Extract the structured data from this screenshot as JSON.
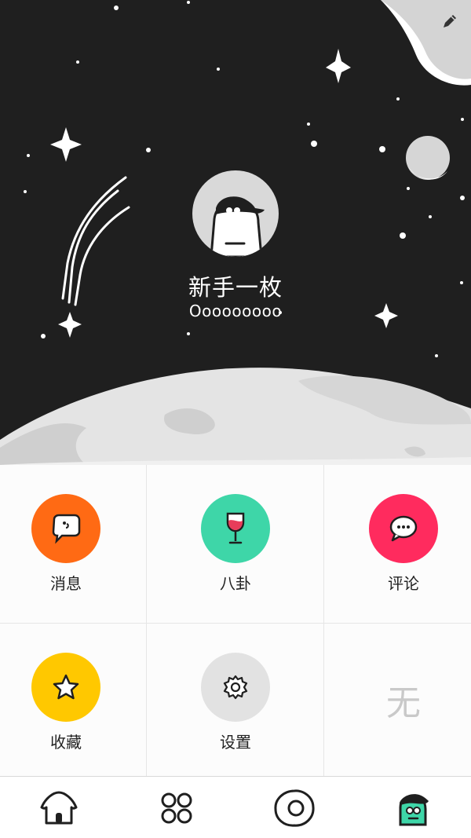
{
  "profile": {
    "name": "新手一枚",
    "signature": "Ooooooooo"
  },
  "grid": {
    "items": [
      {
        "label": "消息",
        "icon": "message-icon",
        "color": "#ff6a14"
      },
      {
        "label": "八卦",
        "icon": "wine-glass-icon",
        "color": "#3ed6a8"
      },
      {
        "label": "评论",
        "icon": "comment-icon",
        "color": "#ff2b5e"
      },
      {
        "label": "收藏",
        "icon": "star-icon",
        "color": "#ffc800"
      },
      {
        "label": "设置",
        "icon": "gear-icon",
        "color": "#e2e2e2"
      }
    ],
    "empty_mark": "无"
  },
  "tabbar": {
    "tabs": [
      {
        "icon": "home-icon",
        "active": false
      },
      {
        "icon": "grid-icon",
        "active": false
      },
      {
        "icon": "egg-icon",
        "active": false
      },
      {
        "icon": "profile-avatar-icon",
        "active": true,
        "accent": "#3ed6a8"
      }
    ]
  },
  "colors": {
    "header_bg": "#1f1f1f",
    "moon": "#d9d9d9",
    "accent": "#3ed6a8"
  }
}
